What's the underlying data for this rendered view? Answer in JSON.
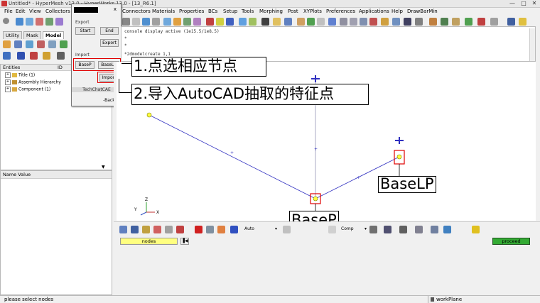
{
  "window": {
    "title": "Untitled* - HyperMesh v13.0 - HyperWorks 13.0 - [13_R6.1]",
    "minimize": "—",
    "maximize": "□",
    "close": "✕"
  },
  "menubar": {
    "items": [
      {
        "label": "File",
        "u": "F"
      },
      {
        "label": "Edit",
        "u": "E"
      },
      {
        "label": "View",
        "u": "V"
      },
      {
        "label": "Collectors",
        "u": "C"
      },
      {
        "label": "Connectors",
        "u": "n"
      },
      {
        "label": "Materials",
        "u": "M"
      },
      {
        "label": "Properties",
        "u": "P"
      },
      {
        "label": "BCs",
        "u": "B"
      },
      {
        "label": "Setup",
        "u": "S"
      },
      {
        "label": "Tools",
        "u": "T"
      },
      {
        "label": "Morphing",
        "u": "M"
      },
      {
        "label": "Post",
        "u": "o"
      },
      {
        "label": "XYPlots",
        "u": "X"
      },
      {
        "label": "Preferences",
        "u": "P"
      },
      {
        "label": "Applications",
        "u": "A"
      },
      {
        "label": "Help",
        "u": "H"
      },
      {
        "label": "DrawBarMin",
        "u": ""
      }
    ]
  },
  "tabs": [
    {
      "label": "Utility"
    },
    {
      "label": "Mask"
    },
    {
      "label": "Model"
    }
  ],
  "entities": {
    "header_left": "Entities",
    "header_right": "ID",
    "tree": [
      {
        "label": "Title (1)",
        "color": "#e8c040"
      },
      {
        "label": "Assembly Hierarchy",
        "color": "#d8a030"
      },
      {
        "label": "Component (1)",
        "color": "#e0b030"
      }
    ]
  },
  "namevalue": {
    "header": "Name Value"
  },
  "popup": {
    "close": "x",
    "export_label": "Export",
    "start": "Start",
    "end": "End",
    "export_btn": "Export",
    "import_label": "Import",
    "basep": "BaseP",
    "baselp": "BaseLP",
    "import_btn": "Import",
    "techchat": "TechChatCAE",
    "back": "-Back-"
  },
  "console": {
    "line1": "console display active (1e15.5/1e8.5)",
    "line2": "*",
    "line3": "*",
    "line4": "*2dmodelcreate 1,1"
  },
  "annotations": {
    "step1": "1.点选相应节点",
    "step2": "2.导入AutoCAD抽取的特征点",
    "basep": "BaseP",
    "baselp": "BaseLP"
  },
  "bottom": {
    "auto": "Auto",
    "comp": "Comp",
    "nodes": "nodes",
    "proceed": "proceed"
  },
  "status": {
    "left": "please select nodes",
    "right": "workPlane"
  },
  "colors": {
    "accent_red": "#e00000",
    "nodes_field": "#ffff80",
    "proceed": "#33aa33",
    "line": "#3030c0"
  }
}
